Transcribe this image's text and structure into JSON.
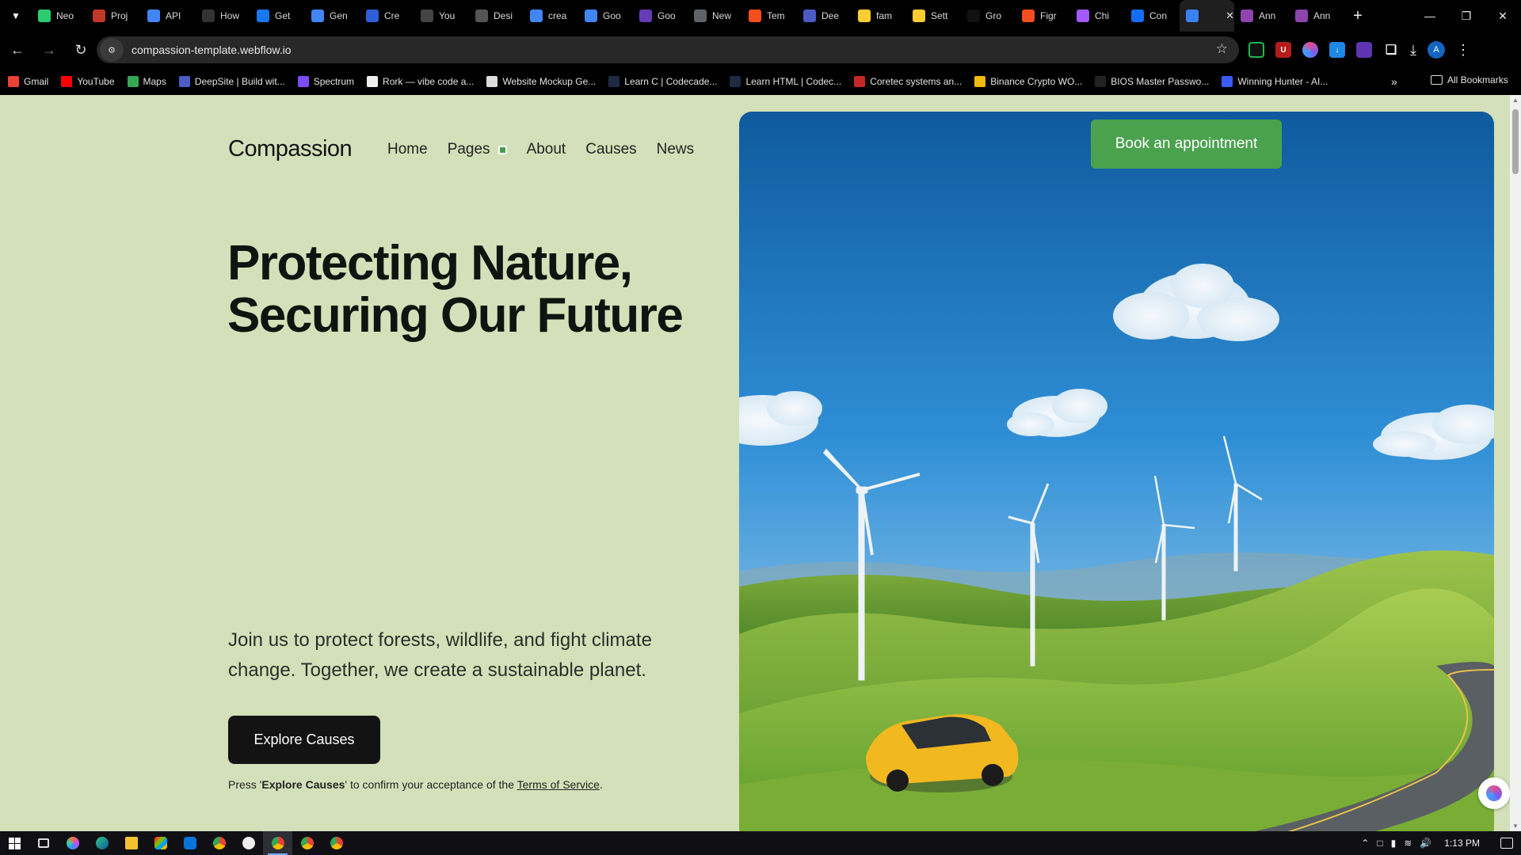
{
  "browser": {
    "tabs": [
      {
        "title": "Neo",
        "icon": "neo-icon",
        "color": "#2ecc71"
      },
      {
        "title": "Proj",
        "icon": "project-icon",
        "color": "#c0392b"
      },
      {
        "title": "API",
        "icon": "google-icon",
        "color": "#4285f4"
      },
      {
        "title": "How",
        "icon": "medium-icon",
        "color": "#333333"
      },
      {
        "title": "Get",
        "icon": "butterfly-icon",
        "color": "#1877f2"
      },
      {
        "title": "Gen",
        "icon": "google-icon",
        "color": "#4285f4"
      },
      {
        "title": "Cre",
        "icon": "rpi-icon",
        "color": "#2e5fd6"
      },
      {
        "title": "You",
        "icon": "github-icon",
        "color": "#444444"
      },
      {
        "title": "Desi",
        "icon": "design-icon",
        "color": "#555555"
      },
      {
        "title": "crea",
        "icon": "google-icon",
        "color": "#4285f4"
      },
      {
        "title": "Goo",
        "icon": "google-icon",
        "color": "#4285f4"
      },
      {
        "title": "Goo",
        "icon": "forms-icon",
        "color": "#673ab7"
      },
      {
        "title": "New",
        "icon": "chrome-icon",
        "color": "#5f6368"
      },
      {
        "title": "Tem",
        "icon": "figma-icon",
        "color": "#f24e1e"
      },
      {
        "title": "Dee",
        "icon": "deepsite-icon",
        "color": "#4b5cc4"
      },
      {
        "title": "fam",
        "icon": "hugging-face-icon",
        "color": "#ffcc33"
      },
      {
        "title": "Sett",
        "icon": "hugging-face-icon",
        "color": "#ffcc33"
      },
      {
        "title": "Gro",
        "icon": "grok-icon",
        "color": "#111111"
      },
      {
        "title": "Figr",
        "icon": "figma-icon",
        "color": "#f24e1e"
      },
      {
        "title": "Chi",
        "icon": "figma-icon",
        "color": "#a259ff"
      },
      {
        "title": "Con",
        "icon": "webflow-icon",
        "color": "#146ef5"
      },
      {
        "title": "",
        "icon": "d-icon",
        "color": "#3b82f6",
        "active": true
      },
      {
        "title": "Ann",
        "icon": "ann-icon",
        "color": "#8e44ad"
      },
      {
        "title": "Ann",
        "icon": "ann-icon",
        "color": "#8e44ad"
      }
    ],
    "new_tab_label": "+",
    "url": "compassion-template.webflow.io",
    "bookmarks": [
      {
        "label": "Gmail",
        "color": "#ea4335"
      },
      {
        "label": "YouTube",
        "color": "#ff0000"
      },
      {
        "label": "Maps",
        "color": "#34a853"
      },
      {
        "label": "DeepSite | Build wit...",
        "color": "#4b5cc4"
      },
      {
        "label": "Spectrum",
        "color": "#7c4dff"
      },
      {
        "label": "Rork — vibe code a...",
        "color": "#eeeeee"
      },
      {
        "label": "Website Mockup Ge...",
        "color": "#dddddd"
      },
      {
        "label": "Learn C | Codecade...",
        "color": "#1f2a44"
      },
      {
        "label": "Learn HTML | Codec...",
        "color": "#1f2a44"
      },
      {
        "label": "Coretec systems an...",
        "color": "#c62828"
      },
      {
        "label": "Binance Crypto WO...",
        "color": "#f0b90b"
      },
      {
        "label": "BIOS Master Passwo...",
        "color": "#222222"
      },
      {
        "label": "Winning Hunter - AI...",
        "color": "#3d5afe"
      }
    ],
    "bookmarks_more": "»",
    "all_bookmarks_label": "All Bookmarks",
    "profile_initial": "A"
  },
  "page": {
    "brand": "Compassion",
    "nav": {
      "home": "Home",
      "pages": "Pages",
      "about": "About",
      "causes": "Causes",
      "news": "News"
    },
    "hero": {
      "title_line1": "Protecting Nature,",
      "title_line2": "Securing Our Future",
      "subtitle_line1": "Join us to protect forests, wildlife, and fight climate",
      "subtitle_line2": "change. Together, we create a sustainable planet.",
      "cta_label": "Explore Causes",
      "note_prefix": "Press '",
      "note_bold": "Explore Causes",
      "note_mid": "' to confirm your acceptance of the ",
      "note_link": "Terms of Service",
      "note_suffix": "."
    },
    "book_button": "Book an appointment",
    "colors": {
      "background": "#d4e0b9",
      "accent": "#4aa24f",
      "cta": "#131313"
    }
  },
  "taskbar": {
    "time": "1:13 PM"
  }
}
